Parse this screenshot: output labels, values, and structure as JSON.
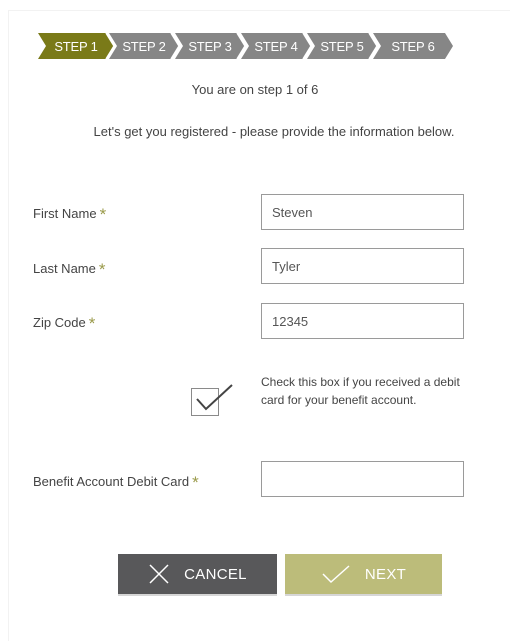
{
  "stepper": {
    "steps": [
      {
        "label": "STEP 1",
        "active": true
      },
      {
        "label": "STEP 2",
        "active": false
      },
      {
        "label": "STEP 3",
        "active": false
      },
      {
        "label": "STEP 4",
        "active": false
      },
      {
        "label": "STEP 5",
        "active": false
      },
      {
        "label": "STEP 6",
        "active": false
      }
    ],
    "active_color": "#7a7a18",
    "inactive_color": "#868686"
  },
  "progress_text": "You are on step 1 of 6",
  "intro_text": "Let's get you registered - please provide the information below.",
  "form": {
    "required_mark": "*",
    "first_name": {
      "label": "First Name",
      "value": "Steven"
    },
    "last_name": {
      "label": "Last Name",
      "value": "Tyler"
    },
    "zip_code": {
      "label": "Zip Code",
      "value": "12345"
    },
    "debit_card_checkbox": {
      "checked": true,
      "label": "Check this box if you received a debit card for your benefit account."
    },
    "debit_card": {
      "label": "Benefit Account Debit Card",
      "value": ""
    }
  },
  "buttons": {
    "cancel_label": "CANCEL",
    "cancel_icon": "close-icon",
    "next_label": "NEXT",
    "next_icon": "checkmark-icon"
  }
}
